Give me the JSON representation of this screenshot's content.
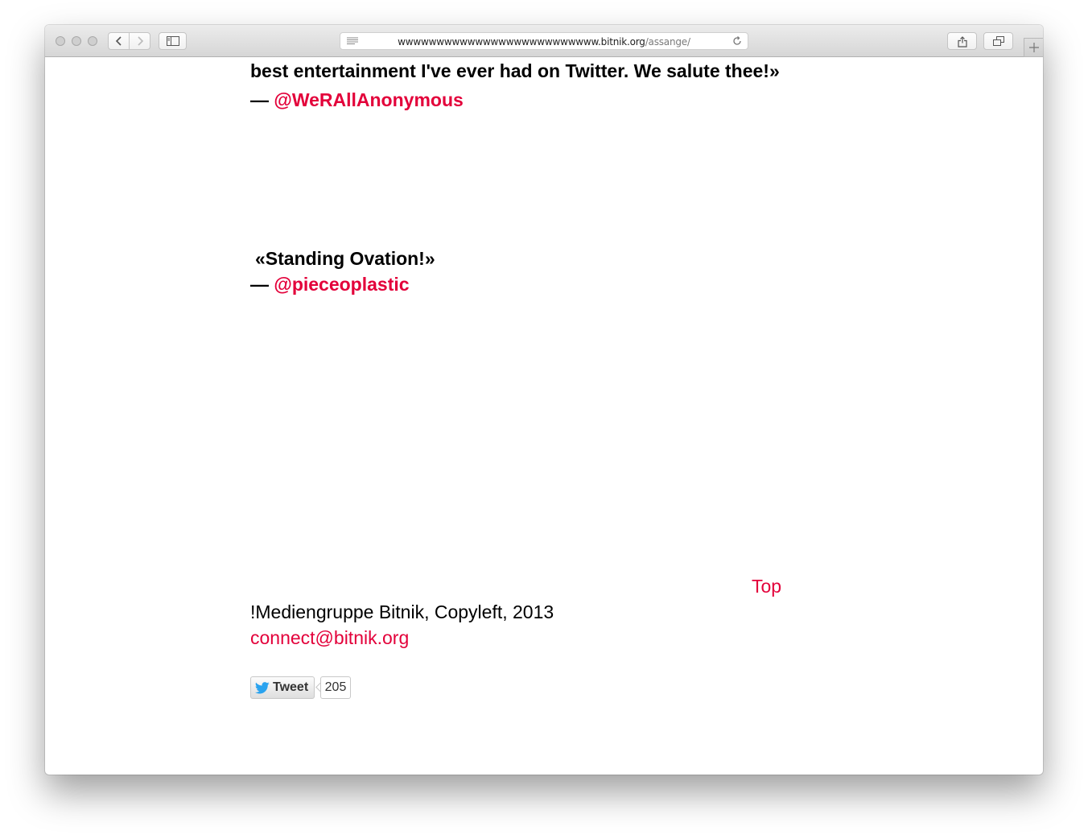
{
  "browser": {
    "url_host": "wwwwwwwwwwwwwwwwwwwwwwwwww.bitnik.org",
    "url_path": "/assange/"
  },
  "page": {
    "cut_line": "best entertainment I've ever had on Twitter. We salute thee!»",
    "quotes": [
      {
        "dash": "— ",
        "handle": "@WeRAllAnonymous"
      },
      {
        "text": "«Standing Ovation!»",
        "dash": "— ",
        "handle": "@pieceoplastic"
      }
    ],
    "top_link": "Top",
    "footer_text": "!Mediengruppe Bitnik, Copyleft, 2013",
    "email": "connect@bitnik.org",
    "tweet": {
      "label": "Tweet",
      "count": "205"
    }
  },
  "colors": {
    "accent": "#e3003a",
    "twitter_blue": "#2aa3ef"
  }
}
